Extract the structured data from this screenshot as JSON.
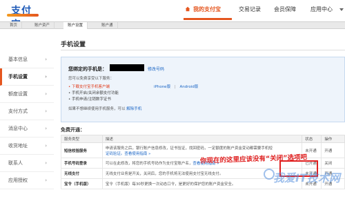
{
  "header": {
    "logo_text": "支付宝",
    "nav": [
      {
        "label": "我的支付宝",
        "active": true
      },
      {
        "label": "交易记录"
      },
      {
        "label": "会员保障"
      },
      {
        "label": "应用中心"
      }
    ]
  },
  "subtabs": [
    "首页",
    "账户资产",
    "账户设置",
    "账户通"
  ],
  "sidebar": {
    "items": [
      "基本信息",
      "手机设置",
      "额度设置",
      "支付方式",
      "消息中心",
      "收货地址",
      "联系人",
      "应用授权"
    ],
    "active_index": 1,
    "arrow": "›"
  },
  "main": {
    "title": "手机设置",
    "bound_label": "您绑定的手机是：",
    "modify_link": "修改号码",
    "desc": "您可以免费享受以下服务：",
    "services": [
      "• 下载支付宝手机客户端",
      "• 手机开启/关闭余额支付功能",
      "• 手机申请/注销数字证书"
    ],
    "app_links": [
      "iPhone版",
      "|",
      "Android版"
    ],
    "unbind_text": "如果不想继续使用手机服务，可以",
    "unbind_link": "解除手机"
  },
  "free_section": {
    "title": "免费开通：",
    "columns": [
      "服务类型",
      "描述",
      "状态",
      "操作"
    ],
    "rows": [
      {
        "name": "短信校验服务",
        "desc": "申请该服务之后，银行账户信息修改，证书验证，找回密码，一定额度的账户资金变动都需要手机短",
        "desc2": "证码验证。查看使用指南 »",
        "status": "未开通",
        "action": "开通"
      },
      {
        "name": "手机号码登录",
        "desc": "可以在此修改，将您的手机号码作为支付宝账户名，",
        "desc2": "查看使用指南 »",
        "status": "已开通",
        "action": "关闭"
      },
      {
        "name": "无线支付",
        "desc": "无线支付业务是开关，关闭后，您的手机将无法使用支付宝无线支付。",
        "desc2": "",
        "status": "未开通",
        "action": "开通"
      },
      {
        "name": "宝令（手机版）",
        "desc": "宝令（手机版）每30秒更换一次动态口令，是更好的保护您的账户资金安全。",
        "desc2": "",
        "status": "未开通",
        "action": "开通"
      }
    ]
  },
  "annotation": "你现在的这里应该没有“关闭”选项吧",
  "watermark": "我爱IT技术网",
  "colors": {
    "accent": "#e5561f",
    "link": "#1a65c5",
    "annotation": "#e02020"
  }
}
